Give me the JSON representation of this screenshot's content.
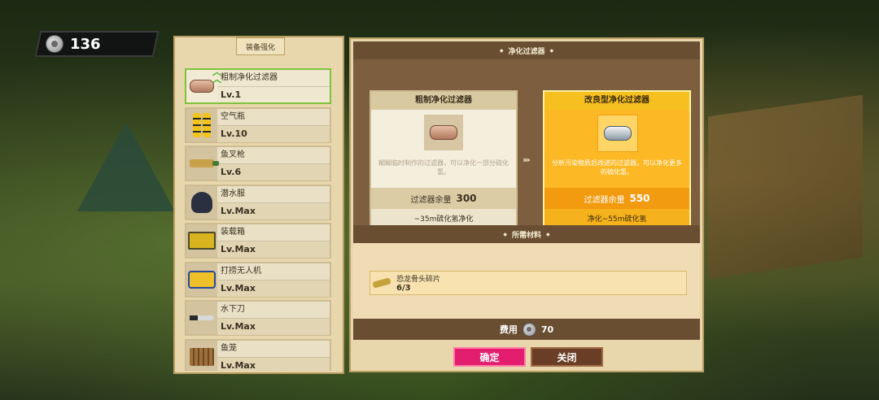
{
  "currency": {
    "icon": "silver-coin-icon",
    "value": "136"
  },
  "left_panel": {
    "header": "装备强化",
    "items": [
      {
        "name": "粗制净化过滤器",
        "level": "Lv.1",
        "icon": "filter-canister-icon",
        "upgradable": true,
        "selected": true
      },
      {
        "name": "空气瓶",
        "level": "Lv.10",
        "icon": "air-tank-icon"
      },
      {
        "name": "鱼叉枪",
        "level": "Lv.6",
        "icon": "harpoon-gun-icon"
      },
      {
        "name": "潜水服",
        "level": "Lv.Max",
        "icon": "diving-suit-icon"
      },
      {
        "name": "装载箱",
        "level": "Lv.Max",
        "icon": "cargo-box-icon"
      },
      {
        "name": "打捞无人机",
        "level": "Lv.Max",
        "icon": "salvage-drone-icon"
      },
      {
        "name": "水下刀",
        "level": "Lv.Max",
        "icon": "dive-knife-icon"
      },
      {
        "name": "鱼笼",
        "level": "Lv.Max",
        "icon": "fish-trap-icon"
      }
    ]
  },
  "right_panel": {
    "section_title": "净化过滤器",
    "current": {
      "title": "粗制净化过滤器",
      "icon": "filter-canister-icon",
      "description": "糊糊临时制作的过滤器，可以净化一部分硫化氢。",
      "remain_label": "过滤器余量",
      "remain_value": "300",
      "effect": "~35m硫化氢净化"
    },
    "next": {
      "title": "改良型净化过滤器",
      "icon": "silver-filter-icon",
      "description": "分析污染物质后改进的过滤器。可以净化更多的硫化氢。",
      "remain_label": "过滤器余量",
      "remain_value": "550",
      "effect": "净化~55m硫化氢"
    },
    "arrows": "›››",
    "materials_title": "所需材料",
    "material": {
      "name": "恐龙骨头碎片",
      "count": "6/3",
      "icon": "dino-bone-icon"
    },
    "cost_label": "费用",
    "cost_value": "70",
    "confirm_label": "确定",
    "close_label": "关闭"
  },
  "colors": {
    "confirm": "#e41e6e",
    "close": "#6a3e26",
    "highlight_card": "#f6b21c",
    "selected_border": "#7ec33e"
  }
}
